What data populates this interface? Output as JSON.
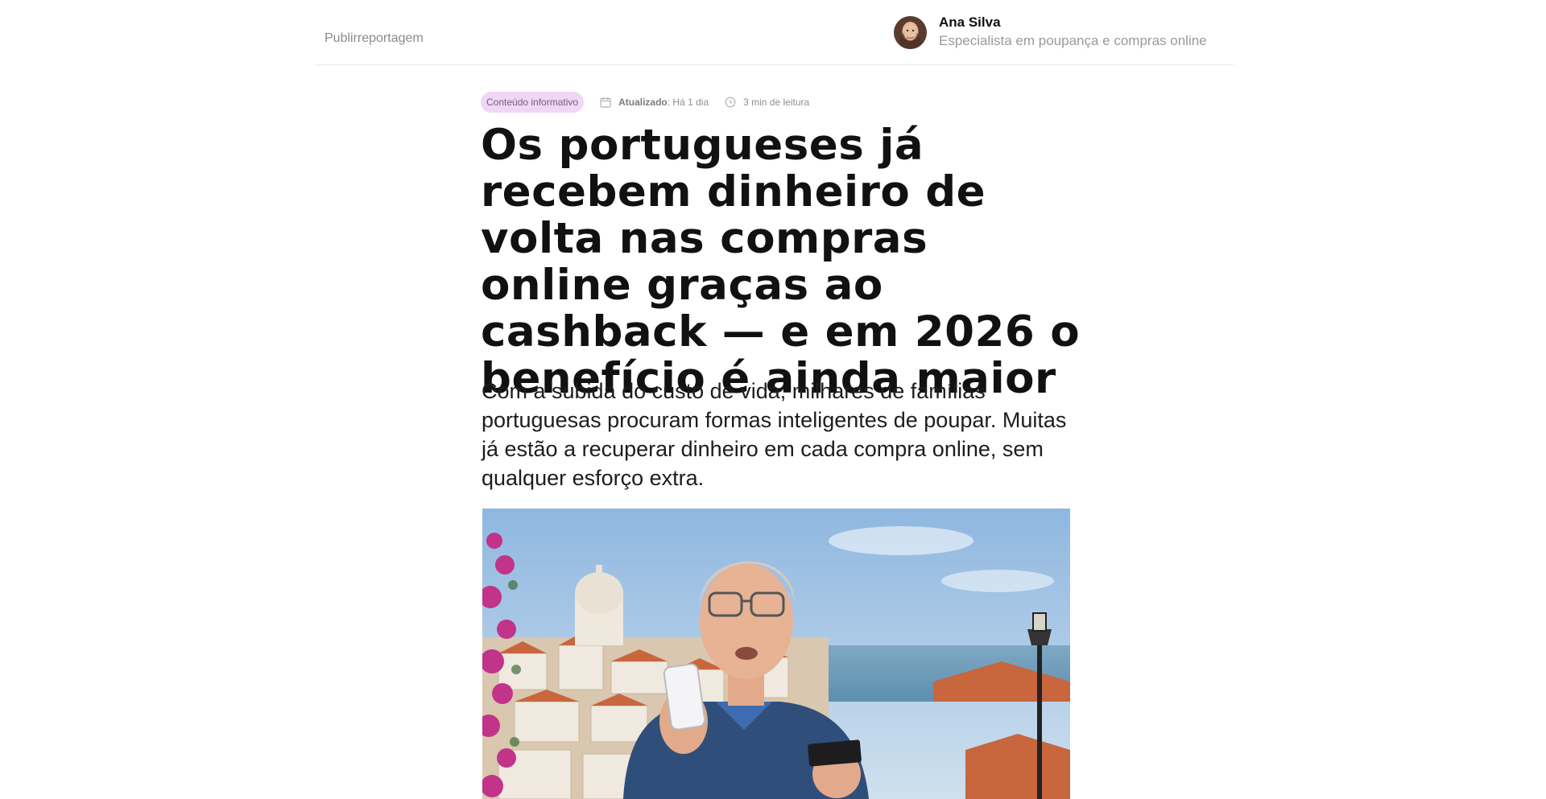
{
  "header": {
    "brand_label": "Publirreportagem",
    "author": {
      "name": "Ana Silva",
      "role": "Especialista em poupança e compras online"
    }
  },
  "article": {
    "badge": "Conteúdo informativo",
    "updated_label": "Atualizado",
    "updated_value": ": Há 1 dia",
    "read_time": "3 min de leitura",
    "headline": "Os portugueses já recebem dinheiro de volta nas compras online graças ao cashback — e em 2026 o benefício é ainda maior",
    "lede": "Com a subida do custo de vida, milhares de famílias portuguesas procuram formas inteligentes de poupar. Muitas já estão a recuperar dinheiro em cada compra online, sem qualquer esforço extra."
  },
  "icons": {
    "calendar": "calendar-icon",
    "clock": "clock-icon"
  },
  "colors": {
    "badge_bg": "#f0d7f6",
    "badge_text": "#7a5b82",
    "muted": "#8f8f8f",
    "divider": "#ececec"
  }
}
